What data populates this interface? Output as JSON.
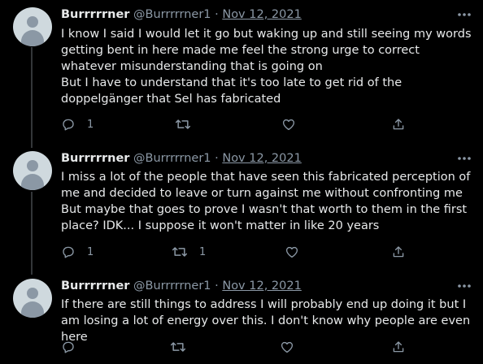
{
  "colors": {
    "background": "#000000",
    "text_primary": "#e7e9ea",
    "text_secondary": "#8b98a5",
    "thread_line": "#333639",
    "avatar_bg": "#cfd9de"
  },
  "tweets": [
    {
      "display_name": "Burrrrrner",
      "handle": "@Burrrrrner1",
      "separator": "·",
      "date": "Nov 12, 2021",
      "lines": [
        "I know I said I would let it go but waking up and still seeing my words getting bent in here made me feel the strong urge to correct whatever misunderstanding that is going on",
        "But I have to understand that it's too late to get rid of the doppelgänger that Sel has fabricated"
      ],
      "replies": "1",
      "retweets": "",
      "likes": ""
    },
    {
      "display_name": "Burrrrrner",
      "handle": "@Burrrrrner1",
      "separator": "·",
      "date": "Nov 12, 2021",
      "lines": [
        "I miss a lot of the people that have seen this fabricated perception of me and decided to leave or turn against me without confronting me",
        "But maybe that goes to prove I wasn't that worth to them in the first place? IDK... I suppose it won't matter in like 20 years"
      ],
      "replies": "1",
      "retweets": "1",
      "likes": ""
    },
    {
      "display_name": "Burrrrrner",
      "handle": "@Burrrrrner1",
      "separator": "·",
      "date": "Nov 12, 2021",
      "lines": [
        "If there are still things to address I will probably end up doing it but I am losing a lot of energy over this. I don't know why people are even here"
      ],
      "replies": "",
      "retweets": "",
      "likes": ""
    }
  ],
  "icons": {
    "more": "more-horizontal-icon",
    "reply": "reply-icon",
    "retweet": "retweet-icon",
    "like": "heart-icon",
    "share": "share-icon"
  }
}
